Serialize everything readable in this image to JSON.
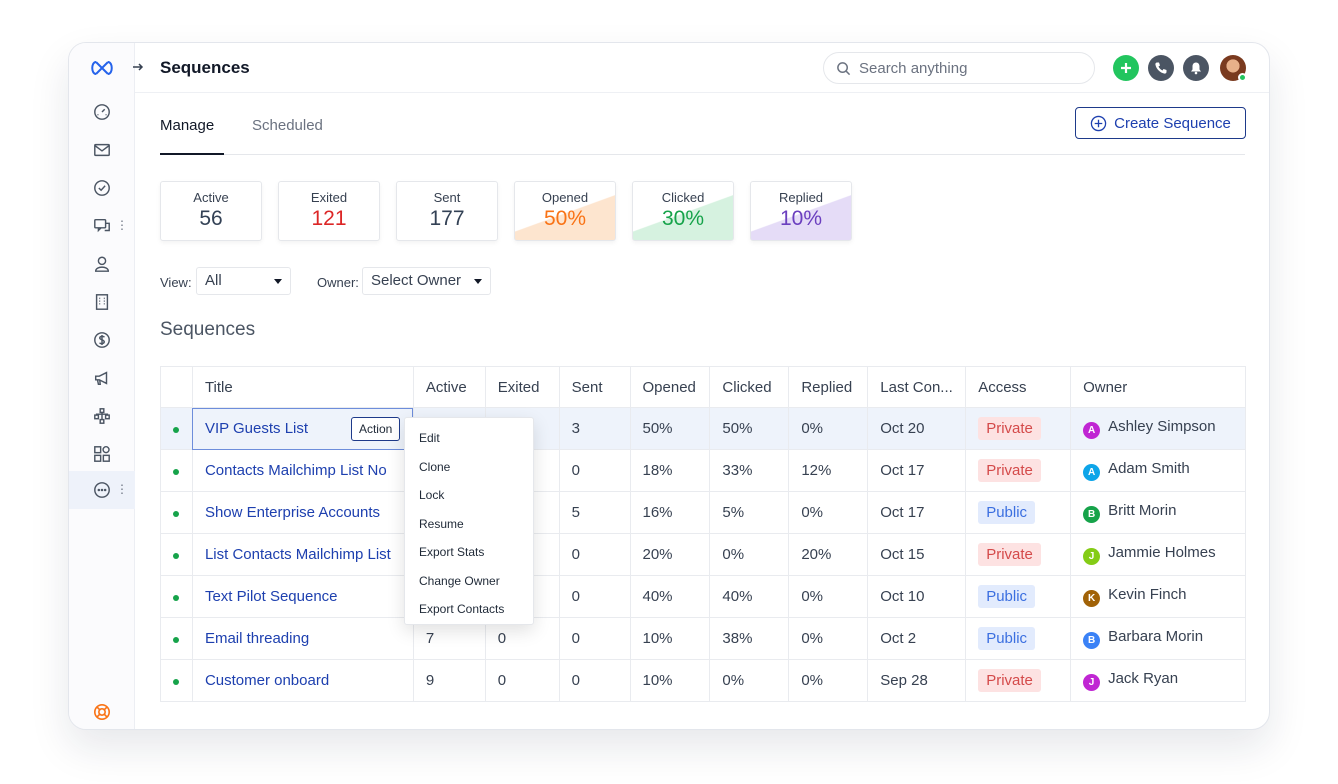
{
  "header": {
    "title": "Sequences",
    "search_placeholder": "Search anything",
    "actions": [
      {
        "name": "add-icon",
        "color": "#22c55e"
      },
      {
        "name": "phone-icon",
        "color": "#4b5563"
      },
      {
        "name": "bell-icon",
        "color": "#4b5563"
      }
    ]
  },
  "sidebar": {
    "items": [
      {
        "name": "dashboard-icon"
      },
      {
        "name": "mail-icon"
      },
      {
        "name": "check-circle-icon"
      },
      {
        "name": "chat-icon"
      },
      {
        "name": "user-icon"
      },
      {
        "name": "building-icon"
      },
      {
        "name": "dollar-icon"
      },
      {
        "name": "megaphone-icon"
      },
      {
        "name": "sitemap-icon"
      },
      {
        "name": "apps-icon"
      },
      {
        "name": "more-icon"
      }
    ],
    "help_icon": "lifebuoy-icon"
  },
  "tabs": {
    "manage": "Manage",
    "scheduled": "Scheduled"
  },
  "create_button": "Create Sequence",
  "stats": [
    {
      "label": "Active",
      "value": "56",
      "color": "#334155"
    },
    {
      "label": "Exited",
      "value": "121",
      "color": "#dc2626"
    },
    {
      "label": "Sent",
      "value": "177",
      "color": "#334155"
    },
    {
      "label": "Opened",
      "value": "50%",
      "color": "#f97316",
      "tint": "#fde5cf"
    },
    {
      "label": "Clicked",
      "value": "30%",
      "color": "#16a34a",
      "tint": "#d6f2e0"
    },
    {
      "label": "Replied",
      "value": "10%",
      "color": "#6b3fbf",
      "tint": "#e5dcf7"
    }
  ],
  "filters": {
    "view_label": "View:",
    "view_value": "All",
    "owner_label": "Owner:",
    "owner_value": "Select Owner"
  },
  "section_title": "Sequences",
  "table": {
    "headers": [
      "",
      "Title",
      "Active",
      "Exited",
      "Sent",
      "Opened",
      "Clicked",
      "Replied",
      "Last Con...",
      "Access",
      "Owner"
    ],
    "action_label": "Action",
    "rows": [
      {
        "title": "VIP Guests List",
        "active": "",
        "exited": "",
        "sent": "3",
        "opened": "50%",
        "clicked": "50%",
        "replied": "0%",
        "last": "Oct 20",
        "access": "Private",
        "owner": "Ashley Simpson",
        "initial": "A",
        "owner_color": "#c026d3"
      },
      {
        "title": "Contacts Mailchimp List No",
        "active": "",
        "exited": "",
        "sent": "0",
        "opened": "18%",
        "clicked": "33%",
        "replied": "12%",
        "last": "Oct 17",
        "access": "Private",
        "owner": "Adam Smith",
        "initial": "A",
        "owner_color": "#0ea5e9"
      },
      {
        "title": "Show Enterprise Accounts",
        "active": "",
        "exited": "",
        "sent": "5",
        "opened": "16%",
        "clicked": "5%",
        "replied": "0%",
        "last": "Oct 17",
        "access": "Public",
        "owner": "Britt Morin",
        "initial": "B",
        "owner_color": "#16a34a"
      },
      {
        "title": "List Contacts Mailchimp List",
        "active": "",
        "exited": "",
        "sent": "0",
        "opened": "20%",
        "clicked": "0%",
        "replied": "20%",
        "last": "Oct 15",
        "access": "Private",
        "owner": "Jammie Holmes",
        "initial": "J",
        "owner_color": "#84cc16"
      },
      {
        "title": "Text Pilot Sequence",
        "active": "",
        "exited": "",
        "sent": "0",
        "opened": "40%",
        "clicked": "40%",
        "replied": "0%",
        "last": "Oct 10",
        "access": "Public",
        "owner": "Kevin Finch",
        "initial": "K",
        "owner_color": "#a16207"
      },
      {
        "title": "Email threading",
        "active": "7",
        "exited": "0",
        "sent": "0",
        "opened": "10%",
        "clicked": "38%",
        "replied": "0%",
        "last": "Oct 2",
        "access": "Public",
        "owner": "Barbara Morin",
        "initial": "B",
        "owner_color": "#3b82f6"
      },
      {
        "title": "Customer onboard",
        "active": "9",
        "exited": "0",
        "sent": "0",
        "opened": "10%",
        "clicked": "0%",
        "replied": "0%",
        "last": "Sep 28",
        "access": "Private",
        "owner": "Jack Ryan",
        "initial": "J",
        "owner_color": "#c026d3"
      }
    ]
  },
  "context_menu": [
    "Edit",
    "Clone",
    "Lock",
    "Resume",
    "Export Stats",
    "Change Owner",
    "Export Contacts"
  ]
}
